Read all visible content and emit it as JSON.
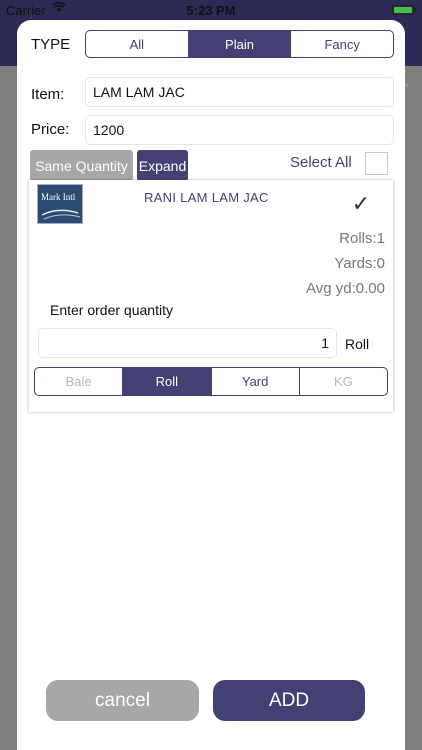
{
  "status_bar": {
    "carrier": "Carrier",
    "time": "5:23 PM",
    "wifi_icon": "wifi-icon",
    "battery_icon": "battery-icon"
  },
  "dialog": {
    "type_label": "TYPE",
    "type_options": [
      "All",
      "Plain",
      "Fancy"
    ],
    "type_selected": "Plain",
    "item_label": "Item:",
    "item_value": "LAM LAM JAC",
    "price_label": "Price:",
    "price_value": "1200",
    "same_quantity_label": "Same Quantity",
    "expand_label": "Expand",
    "select_all_label": "Select All",
    "select_all_checked": false
  },
  "product": {
    "thumbnail_text": "Mark Intl",
    "name": "RANI LAM LAM JAC",
    "checked": true,
    "check_icon": "checkmark-icon",
    "rolls": "Rolls:1",
    "yards": "Yards:0",
    "avg_yd": "Avg yd:0.00",
    "order_label": "Enter order quantity",
    "quantity_value": "1",
    "quantity_unit": "Roll",
    "unit_options": [
      "Bale",
      "Roll",
      "Yard",
      "KG"
    ],
    "unit_selected": "Roll"
  },
  "actions": {
    "cancel_label": "cancel",
    "add_label": "ADD"
  },
  "colors": {
    "brand": "#434174",
    "disabled": "#a7a7a7",
    "overlay": "#7f7f7f"
  }
}
